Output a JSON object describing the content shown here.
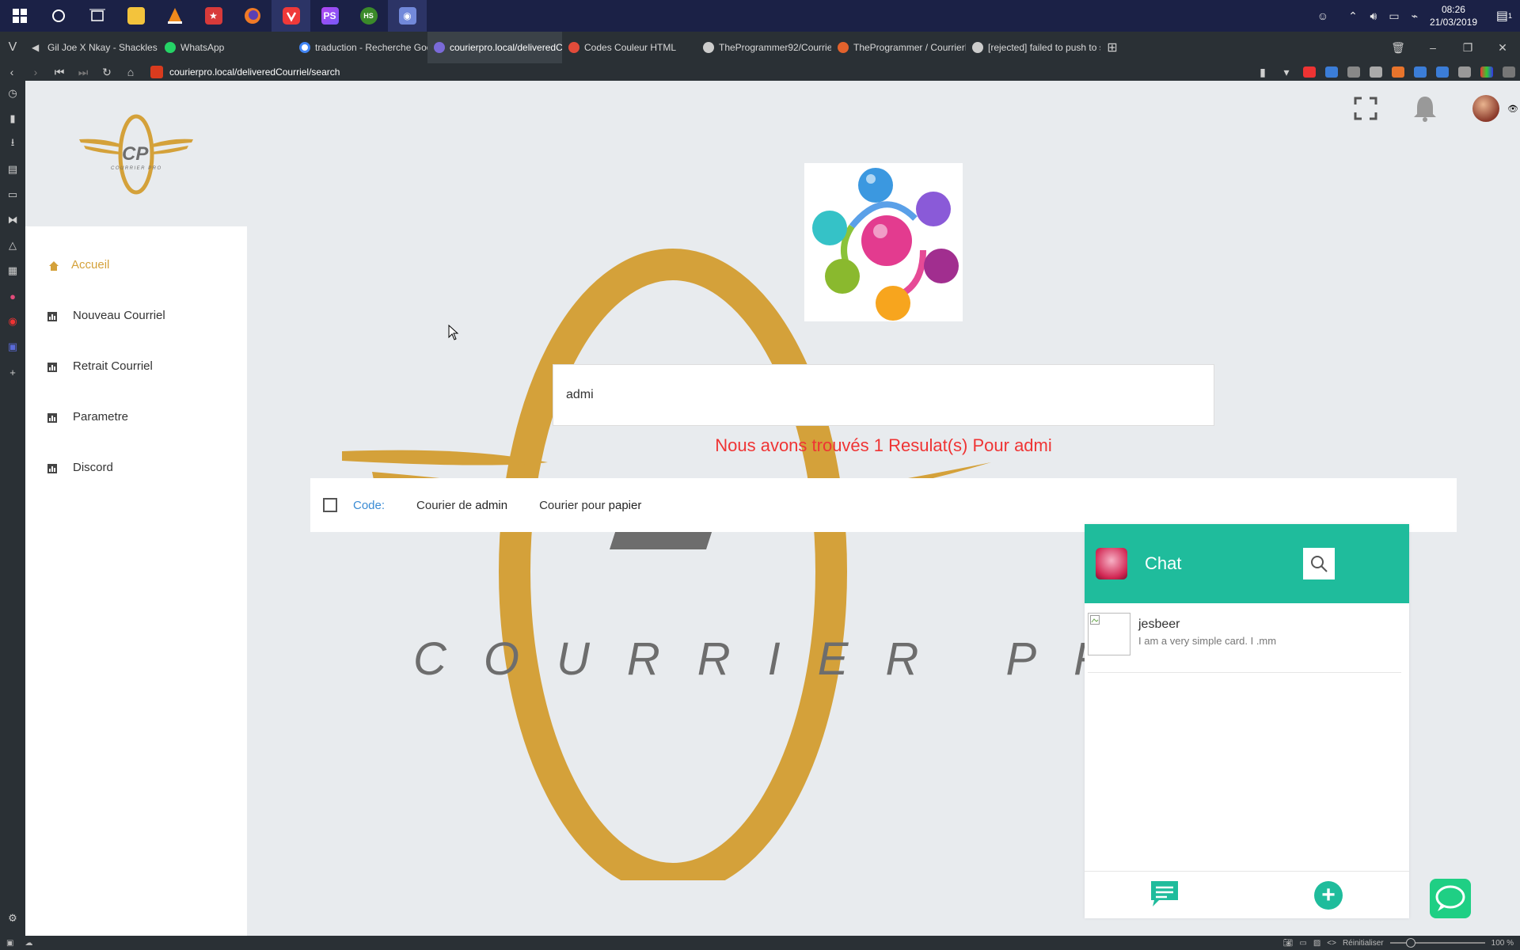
{
  "taskbar": {
    "apps": [
      {
        "icon": "windows-start-icon",
        "color": "#1b2146"
      },
      {
        "icon": "cortana-circle-icon",
        "color": "#1b2146"
      },
      {
        "icon": "task-view-icon",
        "color": "#1b2146"
      },
      {
        "icon": "file-explorer-icon",
        "color": "#f3c33c"
      },
      {
        "icon": "vlc-cone-icon",
        "color": "#f08a1c"
      },
      {
        "icon": "red-app-icon",
        "color": "#d83a3a"
      },
      {
        "icon": "firefox-icon",
        "color": "#f07a26"
      },
      {
        "icon": "vivaldi-icon",
        "color": "#ef3939"
      },
      {
        "icon": "phpstorm-icon",
        "color": "#8a3ec9"
      },
      {
        "icon": "hs-app-icon",
        "color": "#3b8a2a"
      },
      {
        "icon": "discord-badge-icon",
        "color": "#7289da"
      }
    ],
    "hs_label": "HS",
    "ps_label": "PS",
    "clock_time": "08:26",
    "clock_date": "21/03/2019",
    "notif_count": "1"
  },
  "tabs": [
    {
      "title": "Gil Joe X Nkay - Shackles (Ly",
      "color": "#888888",
      "active": false
    },
    {
      "title": "WhatsApp",
      "color": "#25d366",
      "active": false
    },
    {
      "title": "traduction - Recherche Goo",
      "color": "#4285f4",
      "active": false
    },
    {
      "title": "courierpro.local/deliveredCo",
      "color": "#7a6ad8",
      "active": true
    },
    {
      "title": "Codes Couleur HTML",
      "color": "#e24b3a",
      "active": false
    },
    {
      "title": "TheProgrammer92/Courrier",
      "color": "#cccccc",
      "active": false
    },
    {
      "title": "TheProgrammer / CourrierP",
      "color": "#e2622c",
      "active": false
    },
    {
      "title": "[rejected] failed to push to s",
      "color": "#cccccc",
      "active": false
    }
  ],
  "address": {
    "url": "courierpro.local/deliveredCourriel/search"
  },
  "statusbar": {
    "reset_label": "Réinitialiser",
    "zoom": "100 %"
  },
  "sidebar": {
    "items": [
      {
        "label": "Accueil",
        "active": true
      },
      {
        "label": "Nouveau Courriel",
        "active": false
      },
      {
        "label": "Retrait Courriel",
        "active": false
      },
      {
        "label": "Parametre",
        "active": false
      },
      {
        "label": "Discord",
        "active": false
      }
    ]
  },
  "brand": {
    "logo_text": "CP",
    "logo_sub": "COURRIER PRO",
    "watermark_text": "COURRIER PRO",
    "gold": "#d4a13a"
  },
  "search": {
    "value": "admi"
  },
  "result": {
    "message": "Nous avons trouvés 1 Resulat(s) Pour admi",
    "code_label": "Code:",
    "item_a_prefix": "Courier de ",
    "item_a_bold": "admin",
    "item_b_prefix": "Courier pour ",
    "item_b_bold": "papier"
  },
  "chat": {
    "title": "Chat",
    "accent": "#1fbc9c",
    "contacts": [
      {
        "name": "jesbeer",
        "message": "I am a very simple card. I .mm"
      }
    ]
  }
}
